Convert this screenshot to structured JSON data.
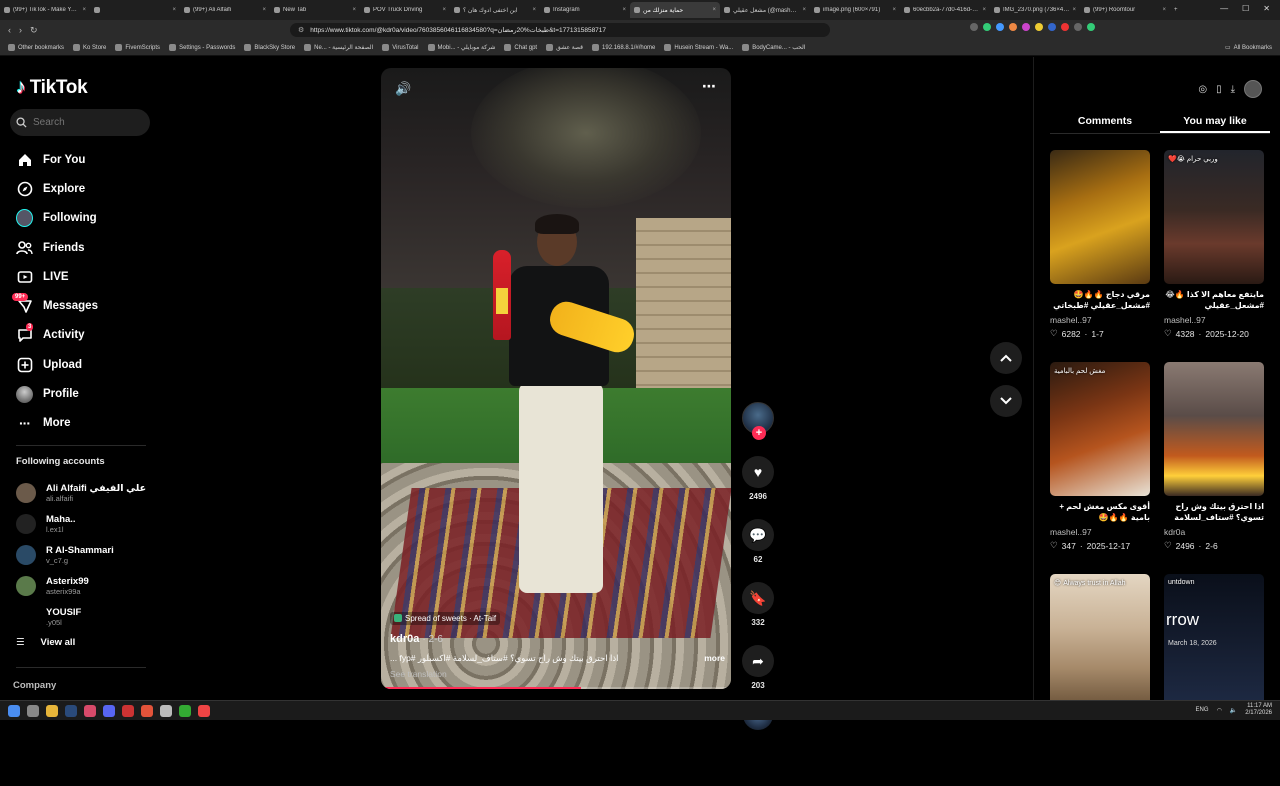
{
  "browser": {
    "tabs": [
      {
        "label": "(99+) TikTok - Make Your...",
        "active": false
      },
      {
        "label": "",
        "active": false
      },
      {
        "label": "(99+) Ali Alfaifi",
        "active": false
      },
      {
        "label": "New Tab",
        "active": false
      },
      {
        "label": "POV Truck Driving",
        "active": false
      },
      {
        "label": "ابن اختفى ادوك هان ؟",
        "active": false
      },
      {
        "label": "Instagram",
        "active": false
      },
      {
        "label": "حماية منزلك من",
        "active": true
      },
      {
        "label": "مشعل عقيلي (@mashel.97)",
        "active": false
      },
      {
        "label": "image.png (600×791)",
        "active": false
      },
      {
        "label": "60ecbb2a-77d0-416d-8...",
        "active": false
      },
      {
        "label": "IMG_2370.png (736×47...",
        "active": false
      },
      {
        "label": "(99+) Roomtour",
        "active": false
      }
    ],
    "url": "https://www.tiktok.com/@kdr0a/video/7603856046116834580?q=طبخات%20رمضان&t=1771315858717",
    "bookmarks": [
      "Other bookmarks",
      "Ko Store",
      "FivemScripts",
      "Settings - Passwords",
      "BlackSky Store",
      "Ne... - الصفحة الرئيسية",
      "VirusTotal",
      "Mobi... - شركة موبايلي",
      "Chat gpt",
      "قصة عشق",
      "192.168.8.1/#/home",
      "Husein Stream - Wa...",
      "BodyCame... - الحب"
    ],
    "all_bookmarks": "All Bookmarks"
  },
  "tiktok": {
    "logo": "TikTok",
    "search_placeholder": "Search",
    "nav": [
      {
        "label": "For You",
        "icon": "home-icon"
      },
      {
        "label": "Explore",
        "icon": "compass-icon"
      },
      {
        "label": "Following",
        "icon": "following-icon"
      },
      {
        "label": "Friends",
        "icon": "friends-icon"
      },
      {
        "label": "LIVE",
        "icon": "live-icon"
      },
      {
        "label": "Messages",
        "icon": "messages-icon",
        "badge": "99+"
      },
      {
        "label": "Activity",
        "icon": "activity-icon",
        "badge": "3"
      },
      {
        "label": "Upload",
        "icon": "upload-icon"
      },
      {
        "label": "Profile",
        "icon": "profile-icon"
      },
      {
        "label": "More",
        "icon": "more-icon"
      }
    ],
    "following_title": "Following accounts",
    "following": [
      {
        "name": "Ali Alfaifi علي الفيفي",
        "user": "ali.alfaifi"
      },
      {
        "name": "Maha..",
        "user": "l.ex1l"
      },
      {
        "name": "R Al-Shammari",
        "user": "v_c7.g"
      },
      {
        "name": "Asterix99",
        "user": "asterix99a"
      },
      {
        "name": "YOUSIF",
        "user": ".y05l"
      }
    ],
    "view_all": "View all",
    "company": "Company"
  },
  "video": {
    "location": "Spread of sweets · At-Taif",
    "author": "kdr0a",
    "date": "2-6",
    "caption": "اذا احترق بيتك وش راح تسوي؟ #ستاف_لسلامة #اكسبلور #fyp ...",
    "more": "more",
    "see_translation": "See translation",
    "progress": 0.57
  },
  "actions": {
    "likes": "2496",
    "comments": "62",
    "saves": "332",
    "shares": "203"
  },
  "right_panel": {
    "tabs": [
      "Comments",
      "You may like"
    ],
    "active_tab": "You may like",
    "cards": [
      {
        "title": "مرقي دجاج 🔥🔥🤩 #مشعل_عقيلي #طبخاتي",
        "user": "mashel..97",
        "likes": "6282",
        "date": "1-7",
        "overlay": "",
        "bg": "linear-gradient(160deg,#3a2a14 0%,#a76e12 35%,#d9a21e 60%,#5a3a12 100%)"
      },
      {
        "title": "مايتفع معاهم الا كذا 🔥😂 #مشعل_عقيلي",
        "user": "mashel..97",
        "likes": "4328",
        "date": "2025-12-20",
        "overlay": "وربي حرام 😭❤️",
        "bg": "linear-gradient(180deg,#22252c 0%,#3a2a24 45%,#6a3a2c 70%,#2a1a14 100%)"
      },
      {
        "title": "أقوى مكس مغش لحم + بامية 🔥🔥🤩",
        "user": "mashel..97",
        "likes": "347",
        "date": "2025-12-17",
        "overlay": "مغش لحم بالبامية",
        "bg": "linear-gradient(160deg,#2a1a10 0%,#7a3514 35%,#b5541e 60%,#e8e2d6 100%)"
      },
      {
        "title": "اذا احترق بيتك وش راح تسوي؟ #ستاف_لسلامة",
        "user": "kdr0a",
        "likes": "2496",
        "date": "2-6",
        "overlay": "",
        "bg": "linear-gradient(180deg,#8a7a72 0%,#5a4c48 40%,#c25a1e 70%,#ffcf3a 85%,#3a2a22 100%)"
      },
      {
        "title": "",
        "user": "",
        "likes": "",
        "date": "",
        "overlay": "Always trust in Allah 😊",
        "bg": "linear-gradient(180deg,#e4d6c2 0%,#c9b296 40%,#a68a6a 70%,#6a5238 100%)"
      },
      {
        "title": "",
        "user": "",
        "likes": "",
        "date": "",
        "overlay": "untdown",
        "big_text": "rrow",
        "sub_text": "March 18, 2026",
        "bg": "linear-gradient(180deg,#0a0f1a 0%,#141c2e 50%,#1e2a44 100%)"
      }
    ]
  },
  "taskbar": {
    "time": "11:17 AM",
    "date": "2/17/2026",
    "lang": "ENG"
  }
}
